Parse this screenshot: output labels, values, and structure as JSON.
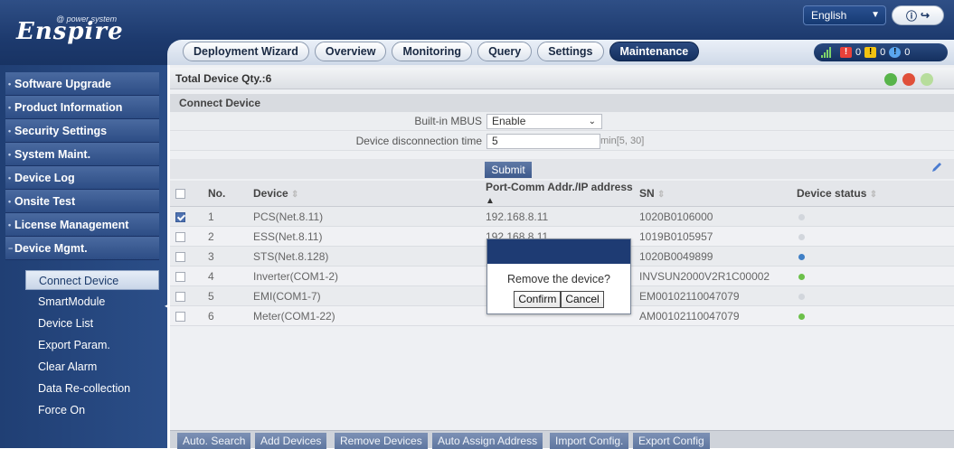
{
  "header": {
    "logo_text": "Enspire",
    "logo_sub": "@ power system",
    "language": "English",
    "nav_tabs": [
      {
        "label": "Deployment Wizard",
        "active": false
      },
      {
        "label": "Overview",
        "active": false
      },
      {
        "label": "Monitoring",
        "active": false
      },
      {
        "label": "Query",
        "active": false
      },
      {
        "label": "Settings",
        "active": false
      },
      {
        "label": "Maintenance",
        "active": true
      }
    ],
    "alarms": {
      "major": "0",
      "minor": "0",
      "warning": "0"
    }
  },
  "sidebar": {
    "items": [
      {
        "label": "Software Upgrade"
      },
      {
        "label": "Product Information"
      },
      {
        "label": "Security Settings"
      },
      {
        "label": "System Maint."
      },
      {
        "label": "Device Log"
      },
      {
        "label": "Onsite Test"
      },
      {
        "label": "License Management"
      },
      {
        "label": "Device Mgmt."
      }
    ],
    "sub_items": [
      {
        "label": "Connect Device",
        "active": true
      },
      {
        "label": "SmartModule"
      },
      {
        "label": "Device List"
      },
      {
        "label": "Export Param."
      },
      {
        "label": "Clear Alarm"
      },
      {
        "label": "Data Re-collection"
      },
      {
        "label": "Force On"
      }
    ]
  },
  "main": {
    "total": "Total Device Qty.:6",
    "section_title": "Connect Device",
    "builtin_mbus_label": "Built-in MBUS",
    "builtin_mbus_value": "Enable",
    "disconnect_label": "Device disconnection time",
    "disconnect_value": "5",
    "disconnect_range": "min[5, 30]",
    "submit": "Submit",
    "table": {
      "headers": {
        "no": "No.",
        "device": "Device",
        "addr": "Port-Comm Addr./IP address",
        "sn": "SN",
        "status": "Device status"
      },
      "rows": [
        {
          "checked": true,
          "no": "1",
          "device": "PCS(Net.8.11)",
          "addr": "192.168.8.11",
          "sn": "1020B0106000",
          "status_color": "#d2d6dc"
        },
        {
          "checked": false,
          "no": "2",
          "device": "ESS(Net.8.11)",
          "addr": "192.168.8.11",
          "sn": "1019B0105957",
          "status_color": "#d2d6dc"
        },
        {
          "checked": false,
          "no": "3",
          "device": "STS(Net.8.128)",
          "addr": "",
          "sn": "1020B0049899",
          "status_color": "#3f7fc6"
        },
        {
          "checked": false,
          "no": "4",
          "device": "Inverter(COM1-2)",
          "addr": "",
          "sn": "INVSUN2000V2R1C00002",
          "status_color": "#6cc04a"
        },
        {
          "checked": false,
          "no": "5",
          "device": "EMI(COM1-7)",
          "addr": "",
          "sn": "EM00102110047079",
          "status_color": "#d2d6dc"
        },
        {
          "checked": false,
          "no": "6",
          "device": "Meter(COM1-22)",
          "addr": "",
          "sn": "AM00102110047079",
          "status_color": "#6cc04a"
        }
      ]
    },
    "bottom_buttons": [
      "Auto. Search",
      "Add Devices",
      "Remove Devices",
      "Auto Assign Address",
      "Import Config.",
      "Export Config"
    ]
  },
  "modal": {
    "message": "Remove the device?",
    "confirm": "Confirm",
    "cancel": "Cancel"
  },
  "colors": {
    "nav_dark": "#1d3a6e",
    "accent_green": "#6cc04a",
    "accent_red": "#e0503a"
  }
}
